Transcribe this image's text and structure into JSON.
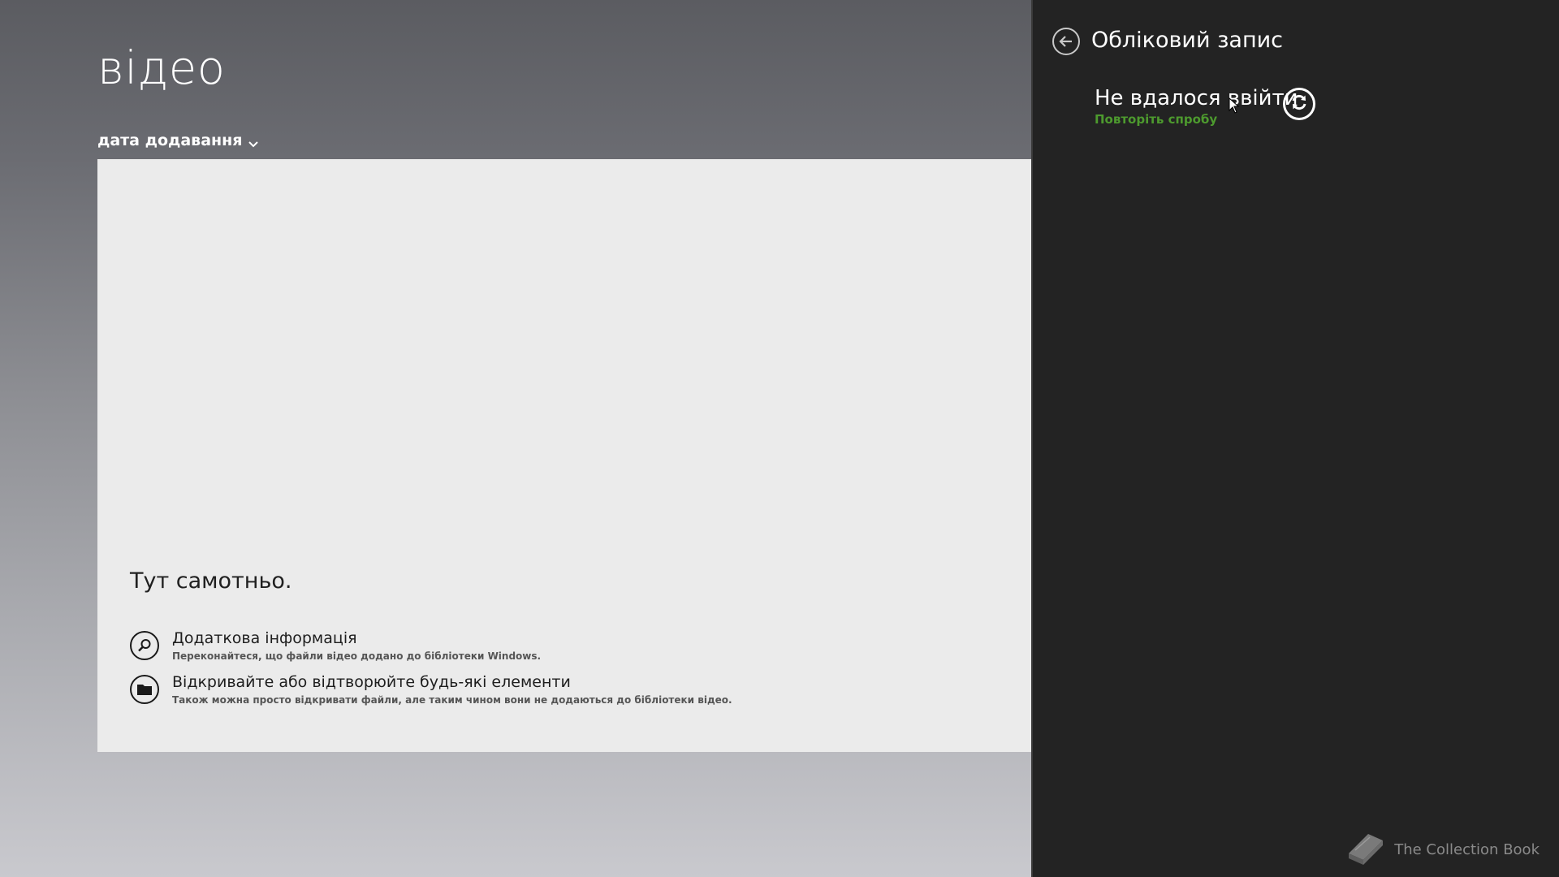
{
  "app": {
    "title": "відео",
    "sort_label": "дата додавання"
  },
  "empty_state": {
    "title": "Тут самотньо.",
    "items": [
      {
        "title": "Додаткова інформація",
        "subtitle": "Переконайтеся, що файли відео додано до бібліотеки Windows.",
        "icon": "search-icon"
      },
      {
        "title": "Відкривайте або відтворюйте будь-які елементи",
        "subtitle": "Також можна просто відкривати файли, але таким чином вони не додаються до бібліотеки відео.",
        "icon": "folder-icon"
      }
    ]
  },
  "account_pane": {
    "title": "Обліковий запис",
    "status": "Не вдалося ввійти",
    "retry_label": "Повторіть спробу",
    "icons": {
      "back": "back-arrow-icon",
      "refresh": "refresh-icon"
    }
  },
  "watermark": {
    "text": "The Collection Book",
    "icon": "book-icon"
  },
  "colors": {
    "pane_bg": "#232323",
    "accent_green": "#4d9a2e",
    "panel_bg": "#ebebeb"
  }
}
